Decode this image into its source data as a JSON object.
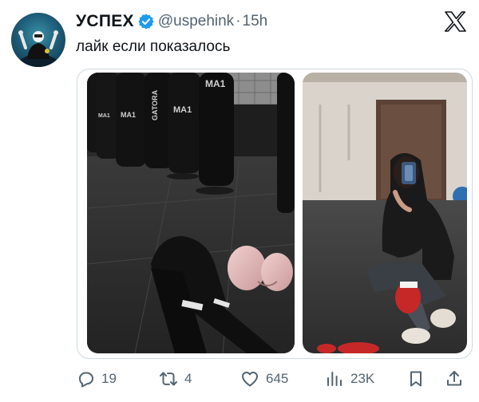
{
  "author": {
    "name": "УСПЕХ",
    "handle": "@uspehink",
    "separator": "·",
    "time": "15h",
    "verified": true
  },
  "tweet": {
    "text": "лайк если показалось"
  },
  "media": {
    "left_photo_icon": "gym-boxing-gloves-photo",
    "right_photo_icon": "mirror-selfie-photo",
    "bag_labels": [
      "GATORA",
      "MA1",
      "MA1",
      "MA1",
      "MA1"
    ]
  },
  "actions": {
    "replies": "19",
    "reposts": "4",
    "likes": "645",
    "views": "23K"
  },
  "colors": {
    "text": "#0f1419",
    "secondary": "#536471",
    "verified": "#1d9bf0",
    "border": "#cfd9de"
  }
}
